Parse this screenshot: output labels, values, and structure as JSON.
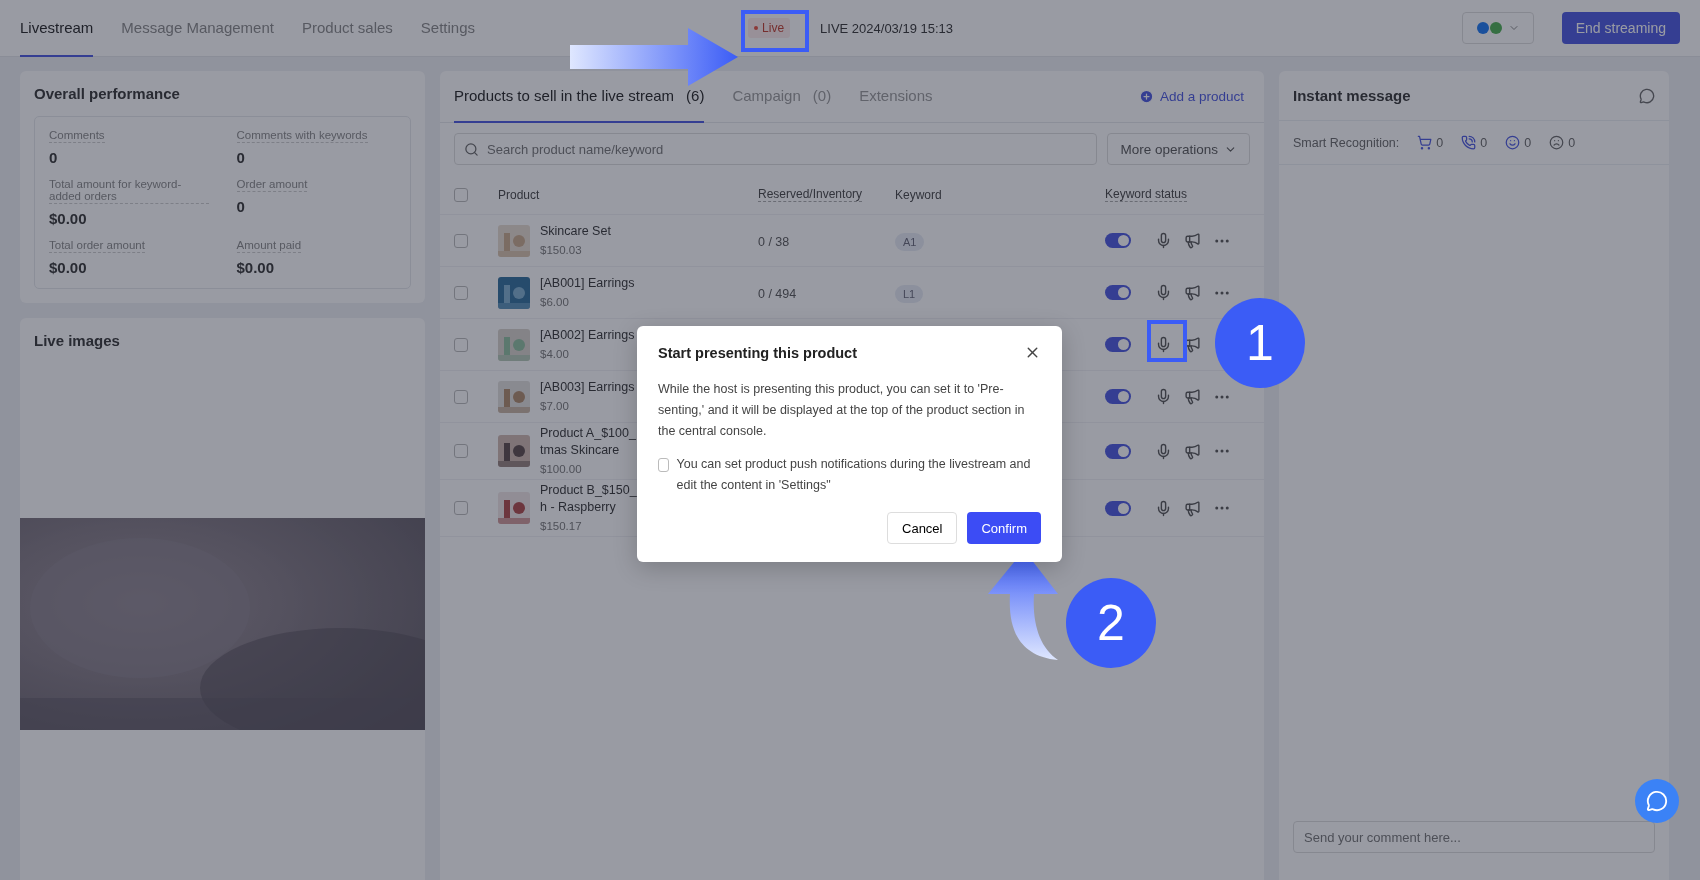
{
  "nav": {
    "tabs": [
      {
        "label": "Livestream",
        "selected": true
      },
      {
        "label": "Message Management",
        "selected": false
      },
      {
        "label": "Product sales",
        "selected": false
      },
      {
        "label": "Settings",
        "selected": false
      }
    ],
    "live_badge": "Live",
    "live_time": "LIVE 2024/03/19 15:13",
    "end_button": "End streaming"
  },
  "performance": {
    "title": "Overall performance",
    "metrics": [
      {
        "label": "Comments",
        "value": "0"
      },
      {
        "label": "Comments with keywords",
        "value": "0"
      },
      {
        "label": "Total amount for keyword-added orders",
        "value": "$0.00"
      },
      {
        "label": "Order amount",
        "value": "0"
      },
      {
        "label": "Total order amount",
        "value": "$0.00"
      },
      {
        "label": "Amount paid",
        "value": "$0.00"
      }
    ]
  },
  "live_images": {
    "title": "Live images"
  },
  "products": {
    "tabs": [
      {
        "label": "Products to sell in the live stream",
        "count": "(6)",
        "selected": true
      },
      {
        "label": "Campaign",
        "count": "(0)",
        "selected": false
      },
      {
        "label": "Extensions",
        "selected": false
      }
    ],
    "add_button": "Add a product",
    "search": {
      "placeholder": "Search product name/keyword"
    },
    "more_button": "More operations",
    "select_all_checked": false,
    "columns": [
      "Product",
      "Reserved/Inventory",
      "Keyword",
      "Keyword status"
    ],
    "rows": [
      {
        "checked": false,
        "name_lines": [
          "Skincare Set"
        ],
        "price": "$150.03",
        "stock": "0 / 38",
        "keyword": "A1",
        "keyword_on": true
      },
      {
        "checked": false,
        "name_lines": [
          "[AB001] Earrings"
        ],
        "price": "$6.00",
        "stock": "0 / 494",
        "keyword": "L1",
        "keyword_on": true
      },
      {
        "checked": false,
        "name_lines": [
          "[AB002] Earrings"
        ],
        "price": "$4.00",
        "keyword_on": true
      },
      {
        "checked": false,
        "name_lines": [
          "[AB003] Earrings"
        ],
        "price": "$7.00",
        "keyword_on": true
      },
      {
        "checked": false,
        "name_lines": [
          "Product A_$100_",
          "tmas Skincare"
        ],
        "price": "$100.00",
        "keyword_on": true
      },
      {
        "checked": false,
        "name_lines": [
          "Product B_$150_",
          "h - Raspberry"
        ],
        "price": "$150.17",
        "keyword_on": true
      }
    ]
  },
  "chat": {
    "title": "Instant message",
    "recognition_label": "Smart Recognition:",
    "counts": [
      {
        "kind": "cart",
        "value": "0"
      },
      {
        "kind": "phone",
        "value": "0"
      },
      {
        "kind": "smile",
        "value": "0"
      },
      {
        "kind": "sad",
        "value": "0"
      }
    ],
    "comment": {
      "placeholder": "Send your comment here..."
    }
  },
  "dialog": {
    "title": "Start presenting this product",
    "body": "While the host is presenting this product, you can set it to 'Pre-senting,' and it will be displayed at the top of the product section in the central console.",
    "checkbox": {
      "label": "You can set product push notifications during the livestream and edit the content in 'Settings\"",
      "checked": false
    },
    "cancel": "Cancel",
    "confirm": "Confirm"
  },
  "annotations": {
    "steps": [
      "1",
      "2"
    ]
  }
}
